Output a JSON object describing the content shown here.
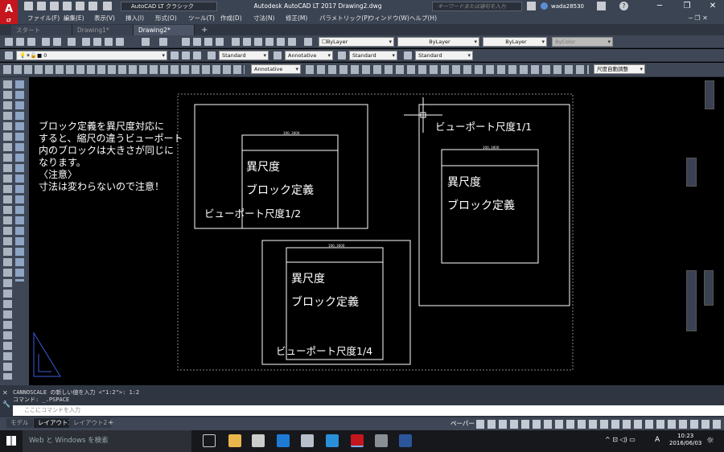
{
  "app": {
    "logo": "A",
    "logo_sub": "LT",
    "workspace": "AutoCAD LT クラシック",
    "title": "Autodesk AutoCAD LT 2017   Drawing2.dwg",
    "search_placeholder": "キーワードまたは語句を入力",
    "user": "wada28530"
  },
  "menu": [
    "ファイル(F)",
    "編集(E)",
    "表示(V)",
    "挿入(I)",
    "形式(O)",
    "ツール(T)",
    "作成(D)",
    "寸法(N)",
    "修正(M)",
    "パラメトリック(P)",
    "ウィンドウ(W)",
    "ヘルプ(H)"
  ],
  "doc_tabs": [
    {
      "label": "スタート",
      "active": false
    },
    {
      "label": "Drawing1*",
      "active": false
    },
    {
      "label": "Drawing2*",
      "active": true
    }
  ],
  "props": {
    "layer_color": "ByLayer",
    "linetype": "ByLayer",
    "lineweight": "ByLayer",
    "plot_color": "ByColor",
    "layer": "0",
    "text_style": "Standard",
    "dim_style": "Annotative",
    "table_style": "Standard",
    "mleader_style": "Standard",
    "annotation_scale_dim": "Annotative",
    "scale_label": "尺度自動調整"
  },
  "drawing": {
    "note_lines": [
      "ブロック定義を異尺度対応に",
      "すると、縮尺の違うビューポート",
      "内のブロックは大きさが同じに",
      "なります。",
      "〈注意〉",
      "寸法は変わらないので注意！"
    ],
    "vp1_label": "ビューポート尺度1/1",
    "vp2_label": "ビューポート尺度1/2",
    "vp4_label": "ビューポート尺度1/4",
    "block_line1": "異尺度",
    "block_line2": "ブロック定義",
    "dim_text": "100, 3000"
  },
  "command": {
    "history1": "CANNOSCALE の新しい値を入力 <\"1:2\">: 1:2",
    "history2": "コマンド: _.PSPACE",
    "input_placeholder": "ここにコマンドを入力"
  },
  "layout_tabs": [
    {
      "label": "モデル",
      "active": false
    },
    {
      "label": "レイアウト1",
      "active": true
    },
    {
      "label": "レイアウト2",
      "active": false
    }
  ],
  "status": {
    "space": "ペーパー"
  },
  "taskbar": {
    "search": "Web と Windows を検索",
    "time": "10:23",
    "date": "2016/06/03",
    "ime": "A"
  },
  "colors": {
    "titlebar": "#3b4453",
    "logo": "#c4161c",
    "canvas": "#000000",
    "drawing": "#ffffff"
  }
}
